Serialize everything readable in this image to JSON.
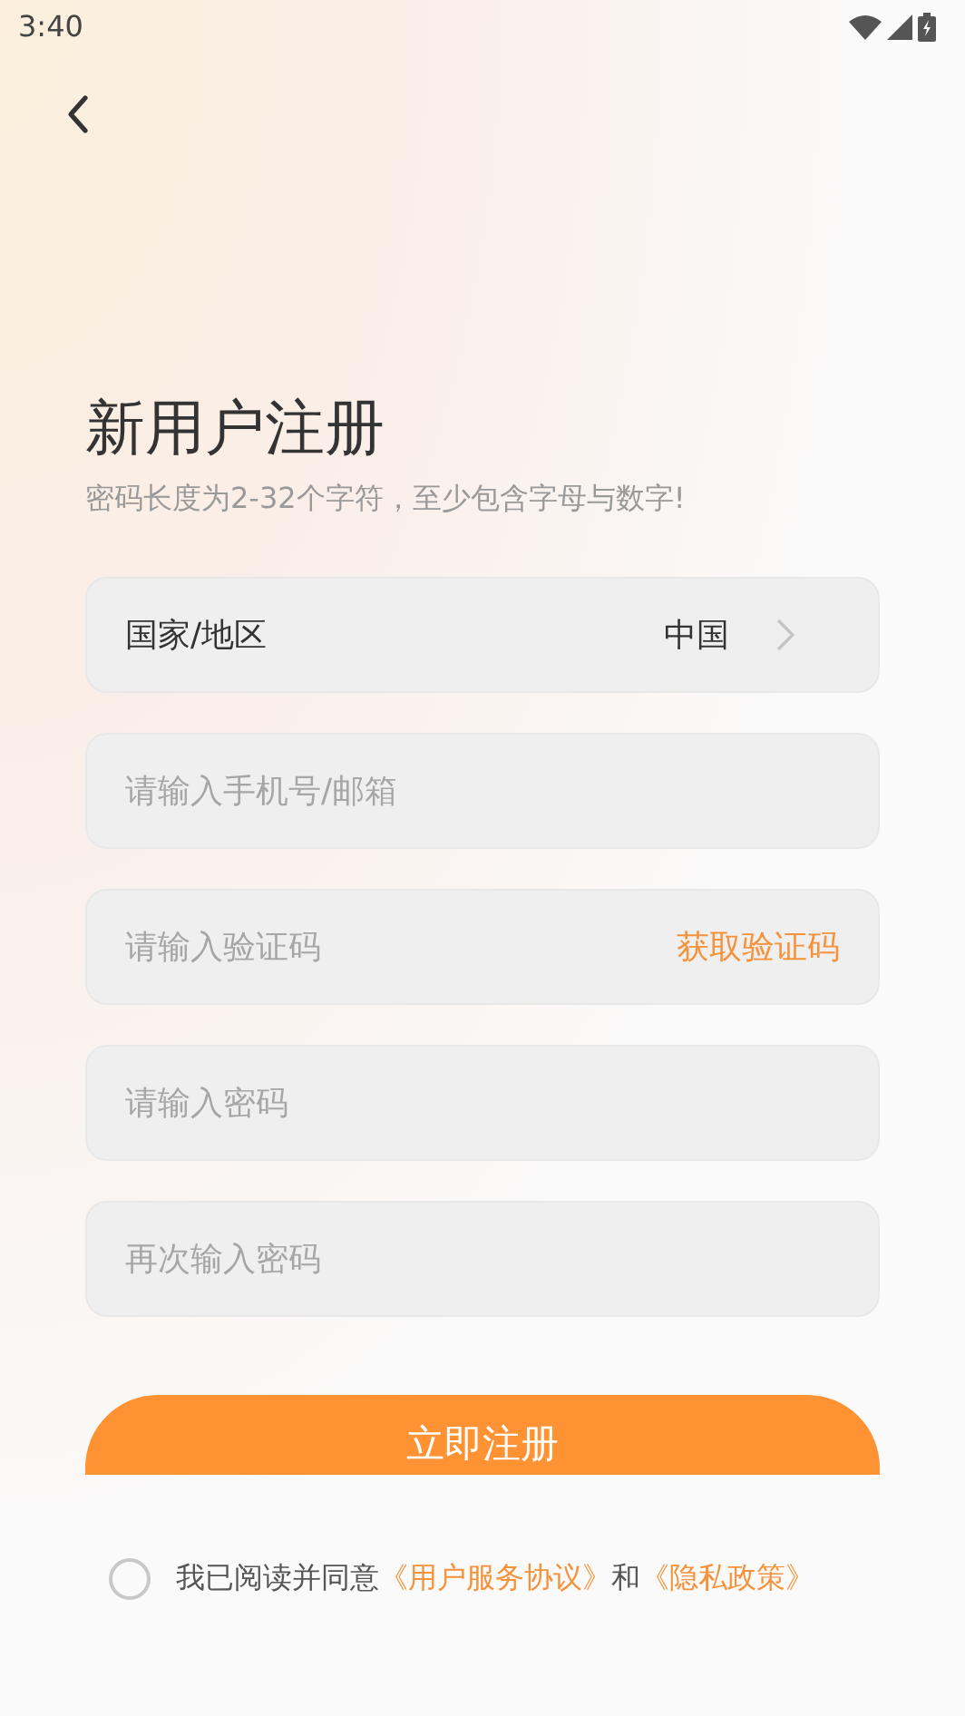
{
  "status_bar": {
    "time": "3:40"
  },
  "title": "新用户注册",
  "subtitle": "密码长度为2-32个字符，至少包含字母与数字!",
  "region": {
    "label": "国家/地区",
    "value": "中国"
  },
  "fields": [
    {
      "kind": "text",
      "placeholder": "请输入手机号/邮箱"
    },
    {
      "kind": "code",
      "placeholder": "请输入验证码",
      "action": "获取验证码"
    },
    {
      "kind": "password",
      "placeholder": "请输入密码"
    },
    {
      "kind": "password",
      "placeholder": "再次输入密码"
    }
  ],
  "submit_button": "立即注册",
  "agreement": {
    "checked": false,
    "text": "我已阅读并同意",
    "terms_link": "《用户服务协议》",
    "conjunction": "和",
    "privacy_link": "《隐私政策》"
  }
}
